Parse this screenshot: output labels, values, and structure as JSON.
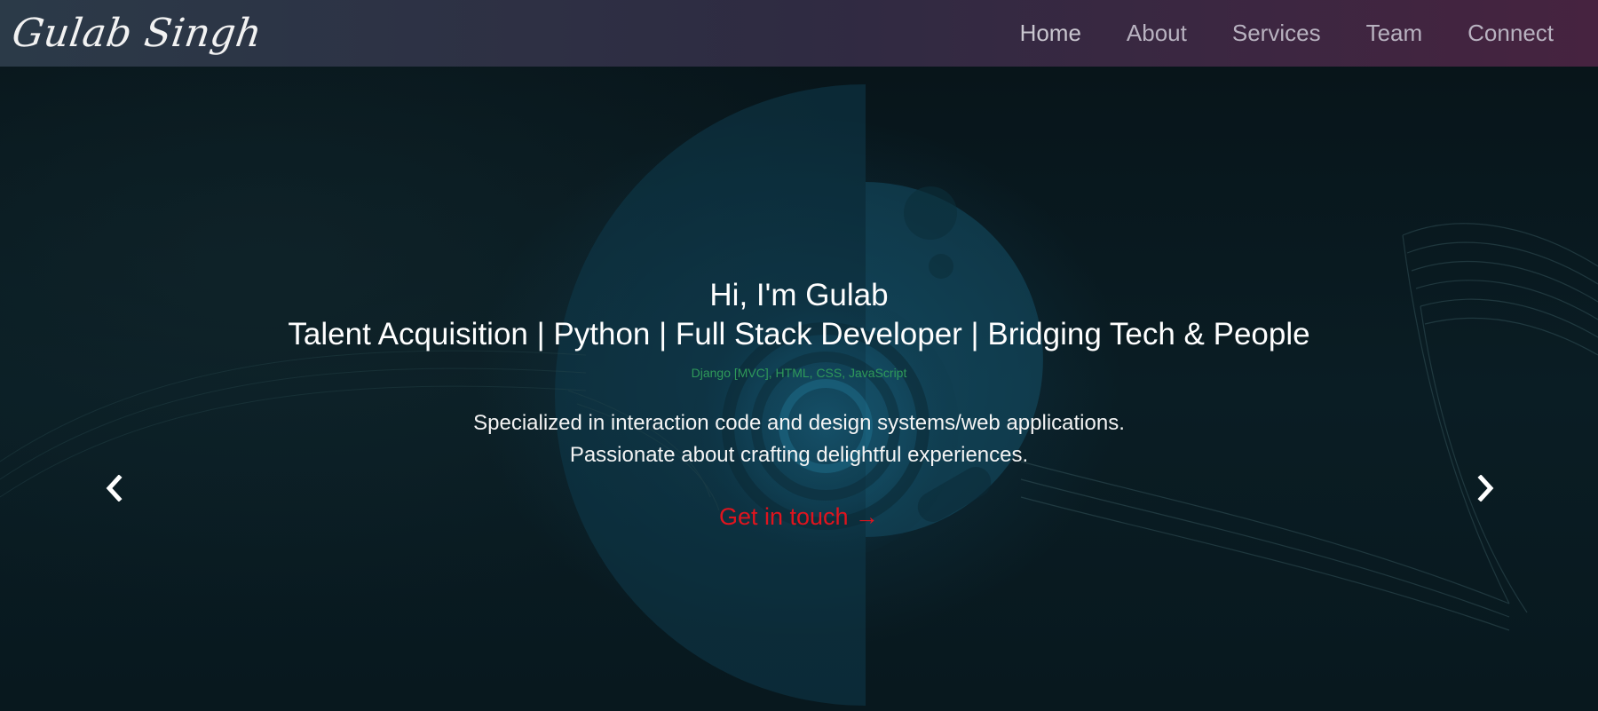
{
  "brand": {
    "name": "Gulab Singh"
  },
  "nav": {
    "items": [
      {
        "label": "Home"
      },
      {
        "label": "About"
      },
      {
        "label": "Services"
      },
      {
        "label": "Team"
      },
      {
        "label": "Connect"
      }
    ]
  },
  "hero": {
    "greeting": "Hi, I'm Gulab",
    "title": "Talent Acquisition | Python | Full Stack Developer | Bridging Tech & People",
    "tech": "Django [MVC], HTML, CSS, JavaScript",
    "desc_line1": "Specialized in interaction code and design systems/web applications.",
    "desc_line2": "Passionate about crafting delightful experiences.",
    "cta": "Get in touch →"
  },
  "carousel": {
    "prev_icon": "chevron-left-icon",
    "next_icon": "chevron-right-icon"
  },
  "colors": {
    "nav_text": "#b8b2c0",
    "tech_text": "#2f9a5a",
    "cta_text": "#e0141e",
    "background": "#061419"
  }
}
